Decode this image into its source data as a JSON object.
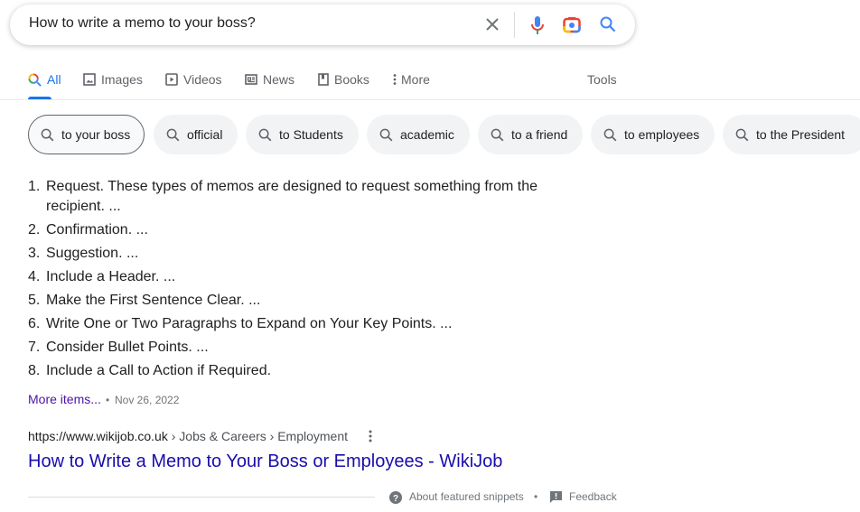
{
  "search": {
    "query": "How to write a memo to your boss?"
  },
  "tabs": [
    {
      "label": "All",
      "icon": "search-icon",
      "active": true
    },
    {
      "label": "Images",
      "icon": "image-icon"
    },
    {
      "label": "Videos",
      "icon": "play-icon"
    },
    {
      "label": "News",
      "icon": "news-icon"
    },
    {
      "label": "Books",
      "icon": "book-icon"
    },
    {
      "label": "More",
      "icon": "more-vert-icon"
    }
  ],
  "tools_label": "Tools",
  "chips": [
    "to your boss",
    "official",
    "to Students",
    "academic",
    "to a friend",
    "to employees",
    "to the President"
  ],
  "snippet": {
    "items": [
      "Request. These types of memos are designed to request something from the recipient. ...",
      "Confirmation. ...",
      "Suggestion. ...",
      "Include a Header. ...",
      "Make the First Sentence Clear. ...",
      "Write One or Two Paragraphs to Expand on Your Key Points. ...",
      "Consider Bullet Points. ...",
      "Include a Call to Action if Required."
    ],
    "numbers": [
      "1.",
      "2.",
      "3.",
      "4.",
      "5.",
      "6.",
      "7.",
      "8."
    ],
    "more_items": "More items...",
    "date": "Nov 26, 2022"
  },
  "result": {
    "url_domain": "https://www.wikijob.co.uk",
    "breadcrumb": " › Jobs & Careers › Employment",
    "title": "How to Write a Memo to Your Boss or Employees - WikiJob"
  },
  "footer": {
    "about": "About featured snippets",
    "sep": "•",
    "feedback": "Feedback"
  },
  "colors": {
    "accent": "#1a73e8",
    "link": "#1a0dab",
    "visited": "#4b11a8"
  }
}
